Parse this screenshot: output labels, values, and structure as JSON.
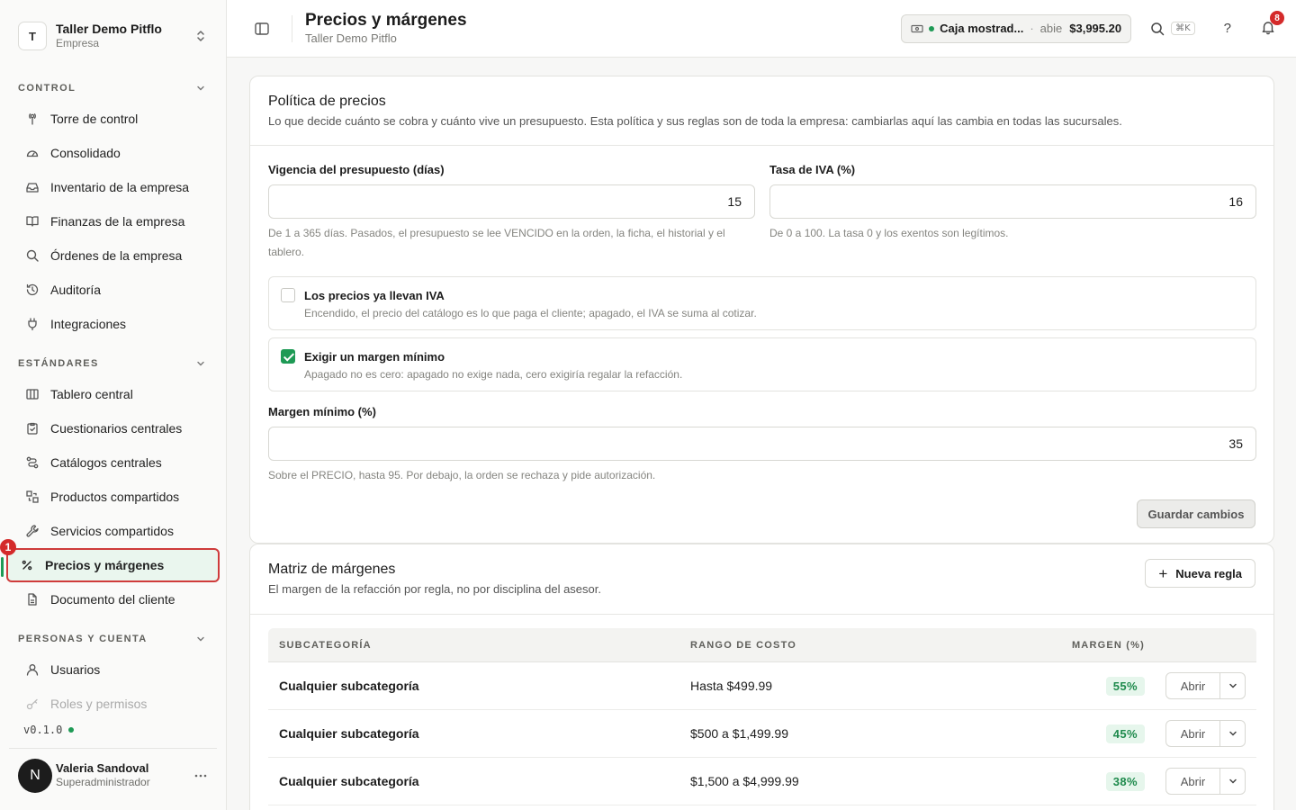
{
  "workspace": {
    "avatar_letter": "T",
    "name": "Taller Demo Pitflo",
    "type": "Empresa"
  },
  "sidebar": {
    "sections": [
      {
        "title": "CONTROL",
        "items": [
          {
            "label": "Torre de control",
            "icon": "tower-icon"
          },
          {
            "label": "Consolidado",
            "icon": "gauge-icon"
          },
          {
            "label": "Inventario de la empresa",
            "icon": "inbox-icon"
          },
          {
            "label": "Finanzas de la empresa",
            "icon": "book-icon"
          },
          {
            "label": "Órdenes de la empresa",
            "icon": "search-icon"
          },
          {
            "label": "Auditoría",
            "icon": "history-icon"
          },
          {
            "label": "Integraciones",
            "icon": "plug-icon"
          }
        ]
      },
      {
        "title": "ESTÁNDARES",
        "items": [
          {
            "label": "Tablero central",
            "icon": "columns-icon"
          },
          {
            "label": "Cuestionarios centrales",
            "icon": "clipboard-icon"
          },
          {
            "label": "Catálogos centrales",
            "icon": "route-icon"
          },
          {
            "label": "Productos compartidos",
            "icon": "boxes-icon"
          },
          {
            "label": "Servicios compartidos",
            "icon": "wrench-icon"
          },
          {
            "label": "Precios y márgenes",
            "icon": "percent-icon",
            "active": true,
            "badge": "1"
          },
          {
            "label": "Documento del cliente",
            "icon": "file-icon"
          }
        ]
      },
      {
        "title": "PERSONAS Y CUENTA",
        "items": [
          {
            "label": "Usuarios",
            "icon": "user-icon"
          },
          {
            "label": "Roles y permisos",
            "icon": "key-icon"
          }
        ]
      }
    ],
    "version": "v0.1.0",
    "user": {
      "avatar_letter": "N",
      "name": "Valeria Sandoval",
      "role": "Superadministrador"
    }
  },
  "header": {
    "title": "Precios y márgenes",
    "subtitle": "Taller Demo Pitflo",
    "cash": {
      "name": "Caja mostrad...",
      "separator": "·",
      "state": "abie",
      "amount": "$3,995.20"
    },
    "shortcut": "⌘K",
    "help": "?",
    "notifications": "8"
  },
  "policy": {
    "title": "Política de precios",
    "description": "Lo que decide cuánto se cobra y cuánto vive un presupuesto. Esta política y sus reglas son de toda la empresa: cambiarlas aquí las cambia en todas las sucursales.",
    "validity_label": "Vigencia del presupuesto (días)",
    "validity_value": "15",
    "validity_help": "De 1 a 365 días. Pasados, el presupuesto se lee VENCIDO en la orden, la ficha, el historial y el tablero.",
    "iva_label": "Tasa de IVA (%)",
    "iva_value": "16",
    "iva_help": "De 0 a 100. La tasa 0 y los exentos son legítimos.",
    "prices_include_iva": {
      "title": "Los precios ya llevan IVA",
      "description": "Encendido, el precio del catálogo es lo que paga el cliente; apagado, el IVA se suma al cotizar.",
      "checked": false
    },
    "require_min_margin": {
      "title": "Exigir un margen mínimo",
      "description": "Apagado no es cero: apagado no exige nada, cero exigiría regalar la refacción.",
      "checked": true
    },
    "min_margin_label": "Margen mínimo (%)",
    "min_margin_value": "35",
    "min_margin_help": "Sobre el PRECIO, hasta 95. Por debajo, la orden se rechaza y pide autorización.",
    "save_label": "Guardar cambios"
  },
  "matrix": {
    "title": "Matriz de márgenes",
    "description": "El margen de la refacción por regla, no por disciplina del asesor.",
    "new_rule_label": "Nueva regla",
    "columns": [
      "SUBCATEGORÍA",
      "RANGO DE COSTO",
      "MARGEN (%)"
    ],
    "open_label": "Abrir",
    "rows": [
      {
        "subcategory": "Cualquier subcategoría",
        "range": "Hasta $499.99",
        "margin": "55%"
      },
      {
        "subcategory": "Cualquier subcategoría",
        "range": "$500 a $1,499.99",
        "margin": "45%"
      },
      {
        "subcategory": "Cualquier subcategoría",
        "range": "$1,500 a $4,999.99",
        "margin": "38%"
      }
    ]
  }
}
